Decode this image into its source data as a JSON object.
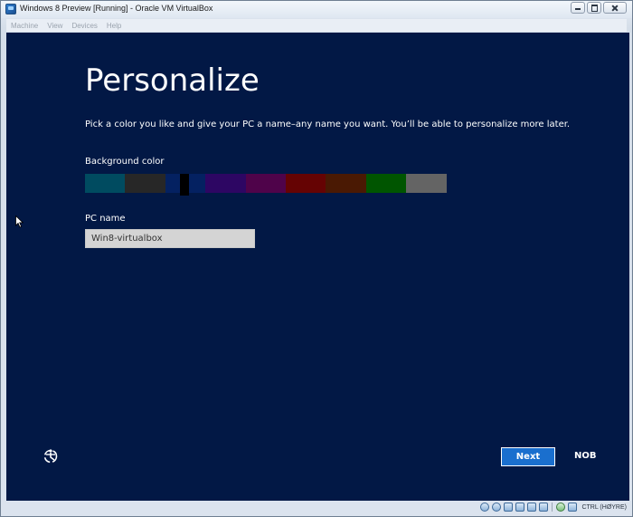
{
  "window": {
    "title": "Windows 8 Preview [Running] - Oracle VM VirtualBox"
  },
  "menu": {
    "items": [
      "Machine",
      "View",
      "Devices",
      "Help"
    ]
  },
  "setup": {
    "heading": "Personalize",
    "description": "Pick a color you like and give your PC a name–any name you want. You’ll be able to personalize more later.",
    "background_label": "Background color",
    "colors": [
      "#004b60",
      "#272727",
      "#042161",
      "#2d0663",
      "#4f034a",
      "#650303",
      "#4a1903",
      "#005500",
      "#646464"
    ],
    "selected_color_index": 2,
    "pc_name_label": "PC name",
    "pc_name_value": "Win8-virtualbox",
    "next_label": "Next",
    "language": "NOB"
  },
  "statusbar": {
    "host_key": "CTRL (HØYRE)"
  }
}
